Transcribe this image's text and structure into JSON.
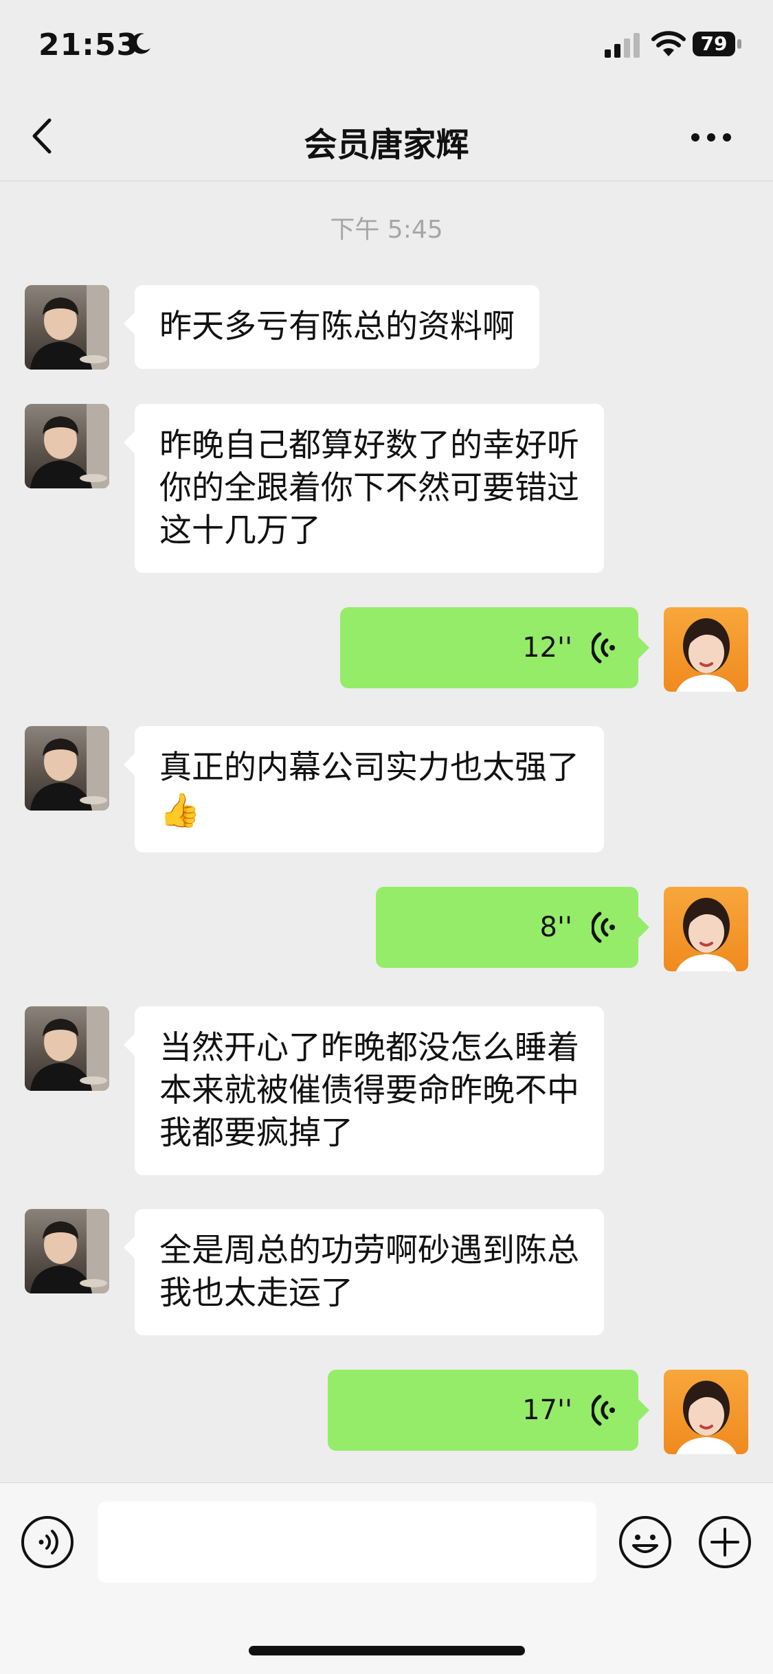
{
  "status_bar": {
    "time": "21:53",
    "battery": "79"
  },
  "nav": {
    "title": "会员唐家辉"
  },
  "timestamp": "下午 5:45",
  "messages": [
    {
      "side": "left",
      "lines": [
        "昨天多亏有陈总的资料啊"
      ]
    },
    {
      "side": "left",
      "lines": [
        "昨晚自己都算好数了的幸好听",
        "你的全跟着你下不然可要错过",
        "这十几万了"
      ]
    },
    {
      "side": "right",
      "type": "voice",
      "duration": "12''"
    },
    {
      "side": "left",
      "lines": [
        "真正的内幕公司实力也太强了"
      ],
      "emoji": "👍"
    },
    {
      "side": "right",
      "type": "voice",
      "duration": "8''"
    },
    {
      "side": "left",
      "lines": [
        "当然开心了昨晚都没怎么睡着",
        "本来就被催债得要命昨晚不中",
        "我都要疯掉了"
      ]
    },
    {
      "side": "left",
      "lines": [
        "全是周总的功劳啊砂遇到陈总",
        "我也太走运了"
      ]
    },
    {
      "side": "right",
      "type": "voice",
      "duration": "17''"
    }
  ],
  "colors": {
    "background": "#ededed",
    "sent_bubble": "#95ec69",
    "received_bubble": "#ffffff"
  },
  "icons": {
    "back": "chevron-left-icon",
    "more": "more-dots-icon",
    "voice_toggle": "voice-input-icon",
    "emoji": "emoji-icon",
    "plus": "plus-icon"
  }
}
